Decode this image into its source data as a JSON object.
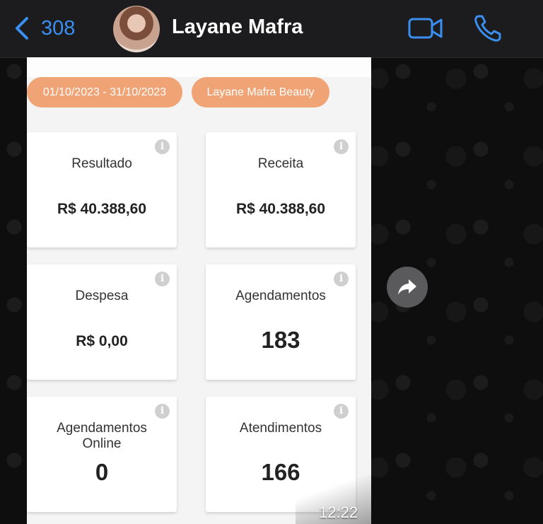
{
  "header": {
    "back_count": "308",
    "contact_name": "Layane Mafra"
  },
  "filters": {
    "date_range": "01/10/2023 - 31/10/2023",
    "business": "Layane Mafra Beauty"
  },
  "cards": [
    {
      "title": "Resultado",
      "value": "R$ 40.388,60"
    },
    {
      "title": "Receita",
      "value": "R$ 40.388,60"
    },
    {
      "title": "Despesa",
      "value": "R$ 0,00"
    },
    {
      "title": "Agendamentos",
      "value": "183"
    },
    {
      "title_line1": "Agendamentos",
      "title_line2": "Online",
      "value": "0"
    },
    {
      "title": "Atendimentos",
      "value": "166"
    }
  ],
  "message": {
    "timestamp": "12:22"
  },
  "colors": {
    "ios_blue": "#3a8ff0",
    "chip_orange": "#f0a375",
    "header_bg": "#1c1c1e"
  },
  "icons": {
    "back": "chevron-left-icon",
    "video": "video-camera-icon",
    "call": "phone-icon",
    "forward": "forward-arrow-icon",
    "info": "info-icon"
  }
}
